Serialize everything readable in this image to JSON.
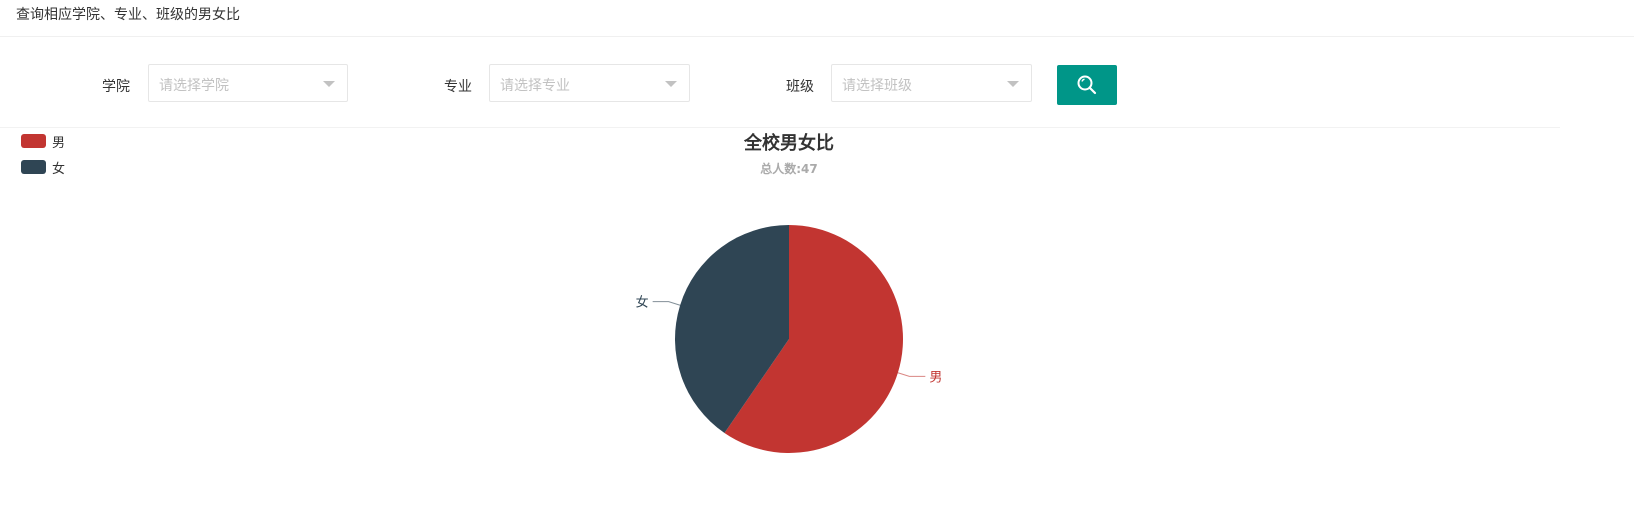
{
  "header": {
    "title": "查询相应学院、专业、班级的男女比"
  },
  "filters": {
    "college": {
      "label": "学院",
      "placeholder": "请选择学院"
    },
    "major": {
      "label": "专业",
      "placeholder": "请选择专业"
    },
    "class": {
      "label": "班级",
      "placeholder": "请选择班级"
    },
    "search_icon": "search-icon",
    "search_color": "#009688"
  },
  "chart_data": {
    "type": "pie",
    "title": "全校男女比",
    "subtitle": "总人数:47",
    "legend_placement": "top-left",
    "slices": [
      {
        "name": "男",
        "value": 28,
        "color": "#c23531"
      },
      {
        "name": "女",
        "value": 19,
        "color": "#2f4554"
      }
    ]
  }
}
